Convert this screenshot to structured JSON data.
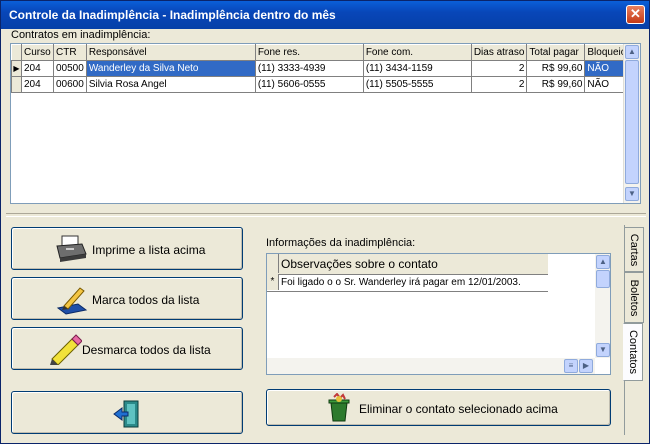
{
  "window": {
    "title": "Controle da Inadimplência - Inadimplência dentro do mês",
    "close_label": "✕"
  },
  "contracts": {
    "label": "Contratos em inadimplência:",
    "columns": [
      "Curso",
      "CTR",
      "Responsável",
      "Fone res.",
      "Fone com.",
      "Dias atraso",
      "Total pagar",
      "Bloqueio"
    ],
    "rows": [
      {
        "curso": "204",
        "ctr": "00500",
        "responsavel": "Wanderley da Silva Neto",
        "fone_res": "(11) 3333-4939",
        "fone_com": "(11) 3434-1159",
        "dias": "2",
        "total": "R$ 99,60",
        "bloqueio": "NÃO",
        "selected": true
      },
      {
        "curso": "204",
        "ctr": "00600",
        "responsavel": "Silvia Rosa Angel",
        "fone_res": "(11) 5606-0555",
        "fone_com": "(11) 5505-5555",
        "dias": "2",
        "total": "R$ 99,60",
        "bloqueio": "NÃO",
        "selected": false
      }
    ],
    "selected_color": "#316ac5"
  },
  "buttons": {
    "print": "Imprime a lista acima",
    "mark_all": "Marca todos da lista",
    "unmark_all": "Desmarca todos da lista",
    "delete_contact": "Eliminar o contato selecionado acima"
  },
  "info": {
    "label": "Informações da inadimplência:",
    "obs_header": "Observações sobre o contato",
    "obs_rows": [
      {
        "marker": "*",
        "text": "Foi ligado o o Sr. Wanderley irá pagar em 12/01/2003."
      }
    ]
  },
  "tabs": [
    {
      "label": "Cartas",
      "active": false
    },
    {
      "label": "Boletos",
      "active": false
    },
    {
      "label": "Contatos",
      "active": true
    }
  ],
  "icons": {
    "printer": "printer-icon",
    "mark": "pen-check-icon",
    "unmark": "eraser-pencil-icon",
    "exit": "exit-door-icon",
    "trash": "trash-bin-icon"
  },
  "colors": {
    "title_bar": "#0846b8",
    "close_button": "#c53a16",
    "panel": "#ece9d8"
  }
}
